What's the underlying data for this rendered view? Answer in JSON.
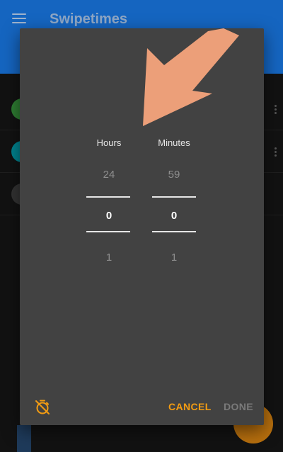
{
  "app": {
    "title": "Swipetimes"
  },
  "picker": {
    "hours_label": "Hours",
    "minutes_label": "Minutes",
    "hours": {
      "prev": "24",
      "selected": "0",
      "next": "1"
    },
    "minutes": {
      "prev": "59",
      "selected": "0",
      "next": "1"
    }
  },
  "actions": {
    "cancel_label": "CANCEL",
    "done_label": "DONE"
  },
  "colors": {
    "accent": "#f39c12",
    "app_bar": "#1565c0",
    "dialog_bg": "#424242",
    "annotation_arrow": "#f5a47c"
  },
  "icons": {
    "menu": "menu-icon",
    "timer_off": "timer-off-icon",
    "annotation": "annotation-arrow-icon"
  }
}
